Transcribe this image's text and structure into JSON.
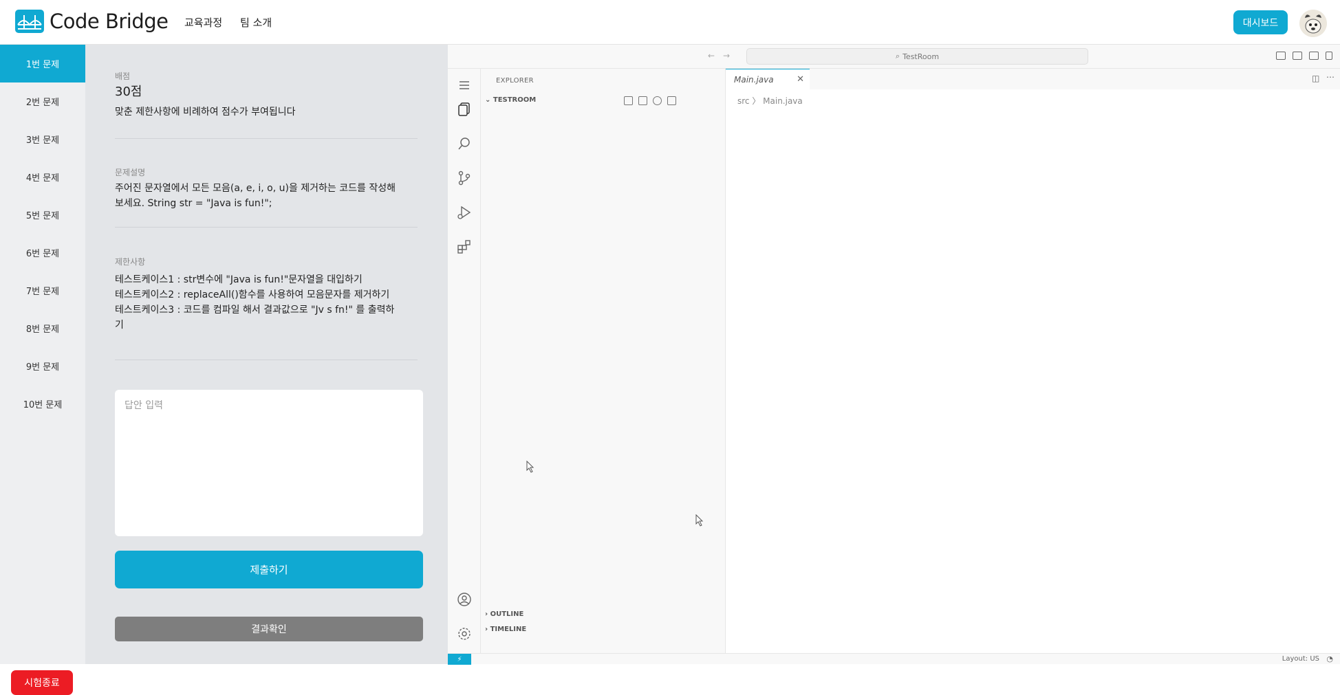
{
  "header": {
    "logo_text": "Code Bridge",
    "nav": [
      "교육과정",
      "팀 소개"
    ],
    "dashboard_label": "대시보드"
  },
  "question_nav": {
    "items": [
      "1번 문제",
      "2번 문제",
      "3번 문제",
      "4번 문제",
      "5번 문제",
      "6번 문제",
      "7번 문제",
      "8번 문제",
      "9번 문제",
      "10번 문제"
    ],
    "active_index": 0,
    "end_label": "시험종료"
  },
  "problem": {
    "score_label": "배점",
    "score_value": "30점",
    "score_desc": "맞춘 제한사항에 비례하여 점수가 부여됩니다",
    "desc_label": "문제설명",
    "desc_line1": "주어진 문자열에서 모든 모음(a, e, i, o, u)을 제거하는 코드를 작성해",
    "desc_line2": "보세요. String str = \"Java is fun!\";",
    "limits_label": "제한사항",
    "limit1": "테스트케이스1 : str변수에 \"Java is fun!\"문자열을 대입하기",
    "limit2": "테스트케이스2 : replaceAll()함수를 사용하여 모음문자를 제거하기",
    "limit3a": "테스트케이스3 : 코드를 컴파일 해서 결과값으로 \"Jv s fn!\" 를 출력하",
    "limit3b": "기",
    "answer_placeholder": "답안 입력",
    "submit_label": "제출하기",
    "result_label": "결과확인"
  },
  "ide": {
    "search_text": "TestRoom",
    "explorer_title": "EXPLORER",
    "root_folder": "TESTROOM",
    "outline_label": "OUTLINE",
    "timeline_label": "TIMELINE",
    "tab_name": "Main.java",
    "breadcrumb": "src  〉 Main.java",
    "status_layout": "Layout: US",
    "accent": "#10a9d2"
  },
  "colors": {
    "brand": "#10a9d2",
    "danger": "#ec1c24",
    "panel_bg": "#e3e5e8",
    "nav_bg": "#eeeff1"
  }
}
